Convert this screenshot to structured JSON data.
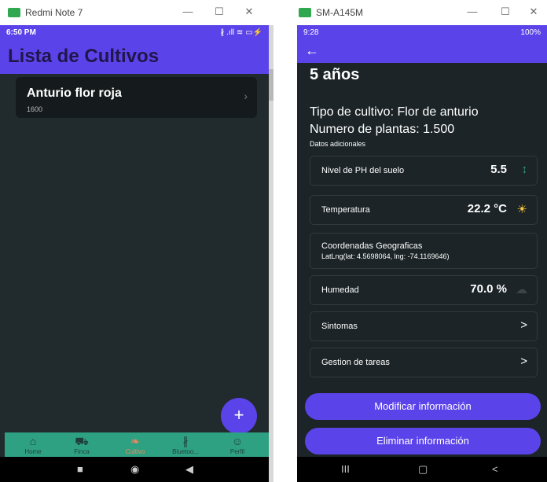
{
  "left_window": {
    "title": "Redmi Note 7",
    "status": {
      "time": "6:50 PM",
      "right": "∦ .ıll ≋ ▭⚡"
    },
    "header_title": "Lista de Cultivos",
    "card": {
      "name": "Anturio flor roja",
      "sub": "1600"
    },
    "fab_label": "+",
    "bottom_nav": [
      {
        "label": "Home",
        "icon": "⌂"
      },
      {
        "label": "Finca",
        "icon": "⛟"
      },
      {
        "label": "Cultivo",
        "icon": "❧"
      },
      {
        "label": "Bluetoo...",
        "icon": "∦"
      },
      {
        "label": "Perfil",
        "icon": "☺"
      }
    ],
    "nav": {
      "square": "■",
      "circle": "◉",
      "back": "◀"
    }
  },
  "right_window": {
    "title": "SM-A145M",
    "status": {
      "time": "9:28",
      "right": "100%"
    },
    "back": "←",
    "years": "5 años",
    "tipo": "Tipo de cultivo: Flor de anturio",
    "numero": "Numero de plantas: 1.500",
    "datos": "Datos adicionales",
    "ph_label": "Nivel de PH del suelo",
    "ph_value": "5.5",
    "temp_label": "Temperatura",
    "temp_value": "22.2 °C",
    "coord_label": "Coordenadas Geograficas",
    "coord_value": "LatLng(lat: 4.5698064, lng: -74.1169646)",
    "hum_label": "Humedad",
    "hum_value": "70.0 %",
    "sintomas": "Sintomas",
    "tareas": "Gestion de tareas",
    "btn_modify": "Modificar información",
    "btn_delete": "Eliminar información",
    "nav": {
      "recent": "III",
      "home": "▢",
      "back": "<"
    }
  },
  "window_controls": {
    "min": "—",
    "max": "☐",
    "close": "✕"
  },
  "colors": {
    "accent": "#5b43ea",
    "nav_green": "#2ea183",
    "bg_dark": "#212a2c"
  }
}
